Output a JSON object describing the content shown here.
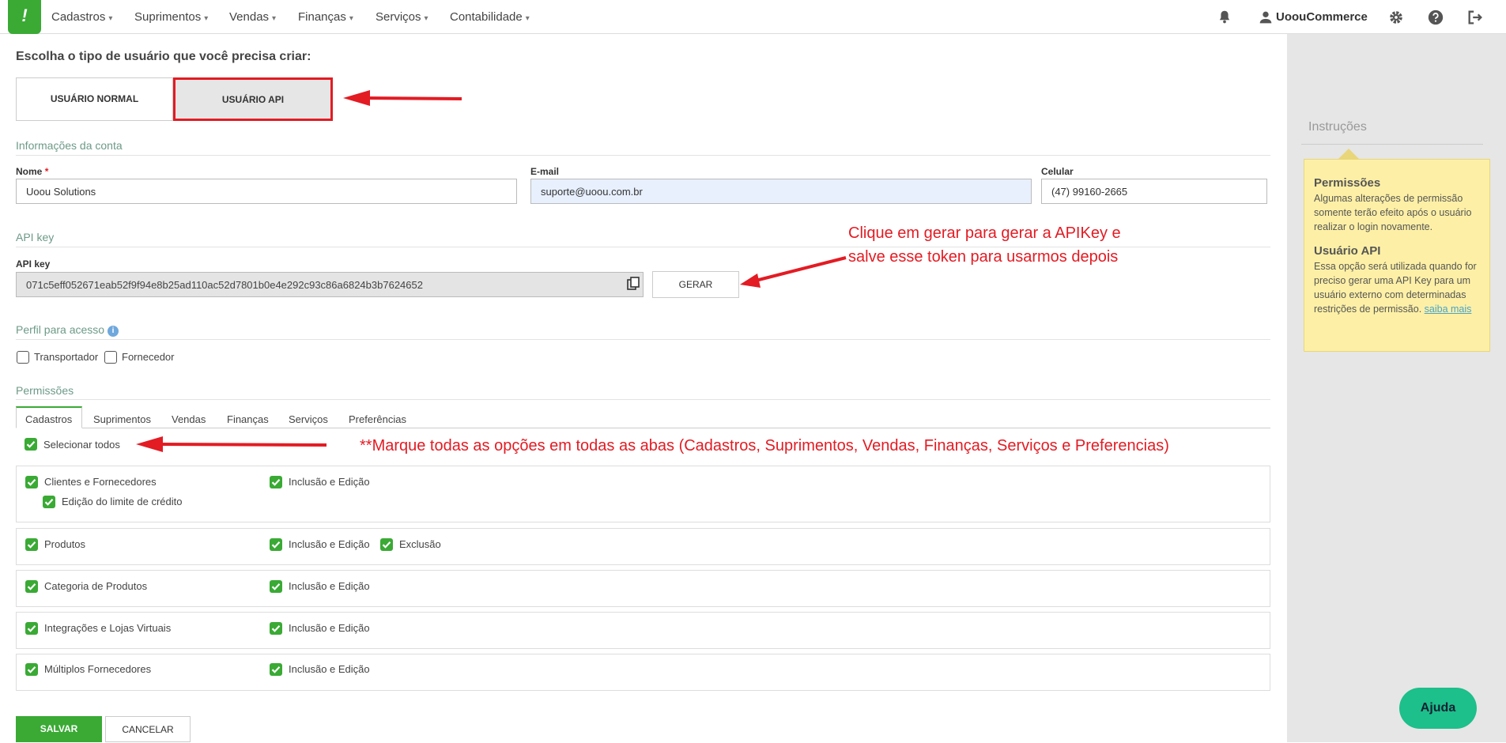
{
  "nav": {
    "logo": "!",
    "items": [
      "Cadastros",
      "Suprimentos",
      "Vendas",
      "Finanças",
      "Serviços",
      "Contabilidade"
    ],
    "user": "UoouCommerce"
  },
  "page": {
    "title": "Escolha o tipo de usuário que você precisa criar:",
    "user_types": {
      "normal": "USUÁRIO NORMAL",
      "api": "USUÁRIO API"
    }
  },
  "account": {
    "section": "Informações da conta",
    "name_label": "Nome",
    "name_required": "*",
    "name_value": "Uoou Solutions",
    "email_label": "E-mail",
    "email_value": "suporte@uoou.com.br",
    "phone_label": "Celular",
    "phone_value": "(47) 99160-2665"
  },
  "apikey": {
    "section": "API key",
    "label": "API key",
    "value": "071c5eff052671eab52f9f94e8b25ad110ac52d7801b0e4e292c93c86a6824b3b7624652",
    "generate": "GERAR"
  },
  "profile": {
    "section": "Perfil para acesso",
    "options": [
      "Transportador",
      "Fornecedor"
    ]
  },
  "permissions": {
    "section": "Permissões",
    "tabs": [
      "Cadastros",
      "Suprimentos",
      "Vendas",
      "Finanças",
      "Serviços",
      "Preferências"
    ],
    "active_tab": "Cadastros",
    "select_all": "Selecionar todos",
    "rows": [
      {
        "name": "Clientes e Fornecedores",
        "sub": "Edição do limite de crédito",
        "opts": [
          "Inclusão e Edição"
        ]
      },
      {
        "name": "Produtos",
        "opts": [
          "Inclusão e Edição",
          "Exclusão"
        ]
      },
      {
        "name": "Categoria de Produtos",
        "opts": [
          "Inclusão e Edição"
        ]
      },
      {
        "name": "Integrações e Lojas Virtuais",
        "opts": [
          "Inclusão e Edição"
        ]
      },
      {
        "name": "Múltiplos Fornecedores",
        "opts": [
          "Inclusão e Edição"
        ]
      }
    ]
  },
  "actions": {
    "save": "SALVAR",
    "cancel": "CANCELAR"
  },
  "sidebar": {
    "title": "Instruções",
    "blocks": [
      {
        "heading": "Permissões",
        "text": "Algumas alterações de permissão somente terão efeito após o usuário realizar o login novamente."
      },
      {
        "heading": "Usuário API",
        "text": "Essa opção será utilizada quando for preciso gerar uma API Key para um usuário externo com determinadas restrições de permissão.",
        "link": "saiba mais"
      }
    ],
    "help_button": "Ajuda"
  },
  "annotations": {
    "generate_line1": "Clique em gerar para gerar a APIKey e",
    "generate_line2": "salve esse token para usarmos depois",
    "tabs_note": "**Marque todas as opções em todas as abas (Cadastros, Suprimentos, Vendas, Finanças, Serviços e Preferencias)"
  },
  "colors": {
    "brand": "#3aaa35",
    "annotation": "#e31b23",
    "help_button": "#1dbf8a"
  }
}
